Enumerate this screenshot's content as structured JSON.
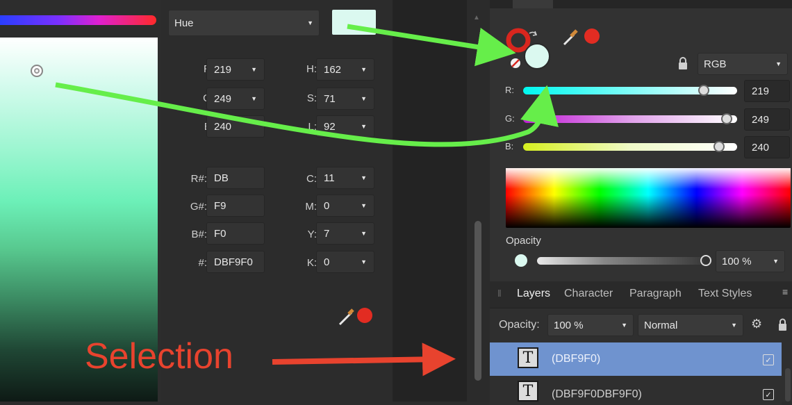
{
  "picker": {
    "mode": "Hue",
    "swatch_color": "#dbf9f0"
  },
  "values": {
    "rgb": [
      {
        "label": "R:",
        "value": "219"
      },
      {
        "label": "G:",
        "value": "249"
      },
      {
        "label": "B:",
        "value": "240"
      }
    ],
    "hsl": [
      {
        "label": "H:",
        "value": "162"
      },
      {
        "label": "S:",
        "value": "71"
      },
      {
        "label": "L:",
        "value": "92"
      }
    ],
    "hex_channels": [
      {
        "label": "R#:",
        "value": "DB"
      },
      {
        "label": "G#:",
        "value": "F9"
      },
      {
        "label": "B#:",
        "value": "F0"
      },
      {
        "label": "#:",
        "value": "DBF9F0"
      }
    ],
    "cmyk": [
      {
        "label": "C:",
        "value": "11"
      },
      {
        "label": "M:",
        "value": "0"
      },
      {
        "label": "Y:",
        "value": "7"
      },
      {
        "label": "K:",
        "value": "0"
      }
    ]
  },
  "color_panel": {
    "model": "RGB",
    "sliders": [
      {
        "label": "R:",
        "value": "219"
      },
      {
        "label": "G:",
        "value": "249"
      },
      {
        "label": "B:",
        "value": "240"
      }
    ],
    "opacity_label": "Opacity",
    "opacity_value": "100 %"
  },
  "layers": {
    "tabs": [
      "Layers",
      "Character",
      "Paragraph",
      "Text Styles"
    ],
    "opacity_label": "Opacity:",
    "opacity_value": "100 %",
    "blend_mode": "Normal",
    "items": [
      {
        "name": "(DBF9F0)",
        "selected": true
      },
      {
        "name": "(DBF9F0DBF9F0)",
        "selected": false
      }
    ]
  },
  "annotation": {
    "selection_label": "Selection",
    "arrow_green": "#66ee4a",
    "arrow_red": "#e8432e"
  }
}
